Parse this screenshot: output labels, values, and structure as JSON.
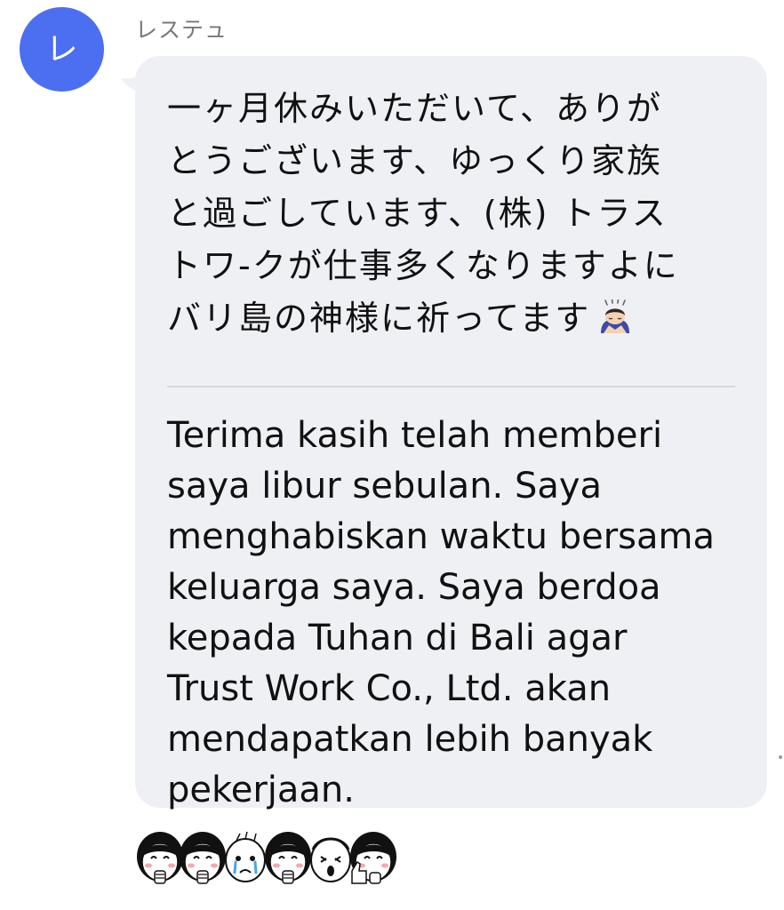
{
  "sender": {
    "avatar_initial": "レ",
    "avatar_color": "#4b6ff0",
    "name": "レステュ"
  },
  "message": {
    "bubble_color": "#eff0f4",
    "divider_color": "#d6d7db",
    "original_text": "一ヶ月休みいただいて、ありが\nとうございます、ゆっくり家族\nと過ごしています、(株) トラス\nトワ-クが仕事多くなりますよに\nバリ島の神様に祈ってます",
    "original_emoji": "bowing-person-emoji",
    "translation_text": "Terima kasih telah memberi\nsaya libur sebulan. Saya\nmenghabiskan waktu bersama\nkeluarga saya. Saya berdoa\nkepada Tuhan di Bali agar\nTrust Work Co., Ltd. akan\nmendapatkan lebih banyak\npekerjaan."
  },
  "sticker": {
    "name": "girls-reaction-sticker",
    "faces": [
      "smiling-girl",
      "smiling-girl",
      "crying-girl",
      "smiling-girl",
      "surprised-girl",
      "thumbs-up-girl"
    ]
  }
}
